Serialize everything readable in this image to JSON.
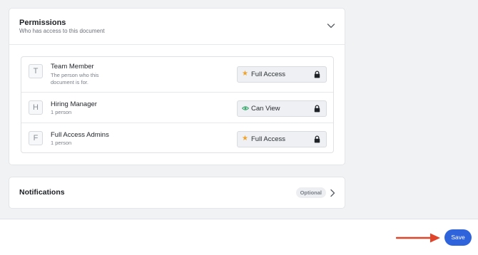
{
  "permissions": {
    "title": "Permissions",
    "subtitle": "Who has access to this document",
    "toggle_icon": "chevron-down-icon",
    "rows": [
      {
        "initial": "T",
        "name": "Team Member",
        "description": "The person who this document is for.",
        "access": {
          "label": "Full Access",
          "icon": "star-icon",
          "locked": true
        }
      },
      {
        "initial": "H",
        "name": "Hiring Manager",
        "description": "1 person",
        "access": {
          "label": "Can View",
          "icon": "eye-icon",
          "locked": true
        }
      },
      {
        "initial": "F",
        "name": "Full Access Admins",
        "description": "1 person",
        "access": {
          "label": "Full Access",
          "icon": "star-icon",
          "locked": true
        }
      }
    ]
  },
  "notifications": {
    "title": "Notifications",
    "badge": "Optional",
    "expand_icon": "chevron-right-icon"
  },
  "footer": {
    "save_label": "Save"
  },
  "colors": {
    "accent": "#2f63dc",
    "annotation_arrow": "#e0452c",
    "star": "#f0a32a",
    "view": "#3aa76d",
    "background": "#f1f2f4"
  }
}
